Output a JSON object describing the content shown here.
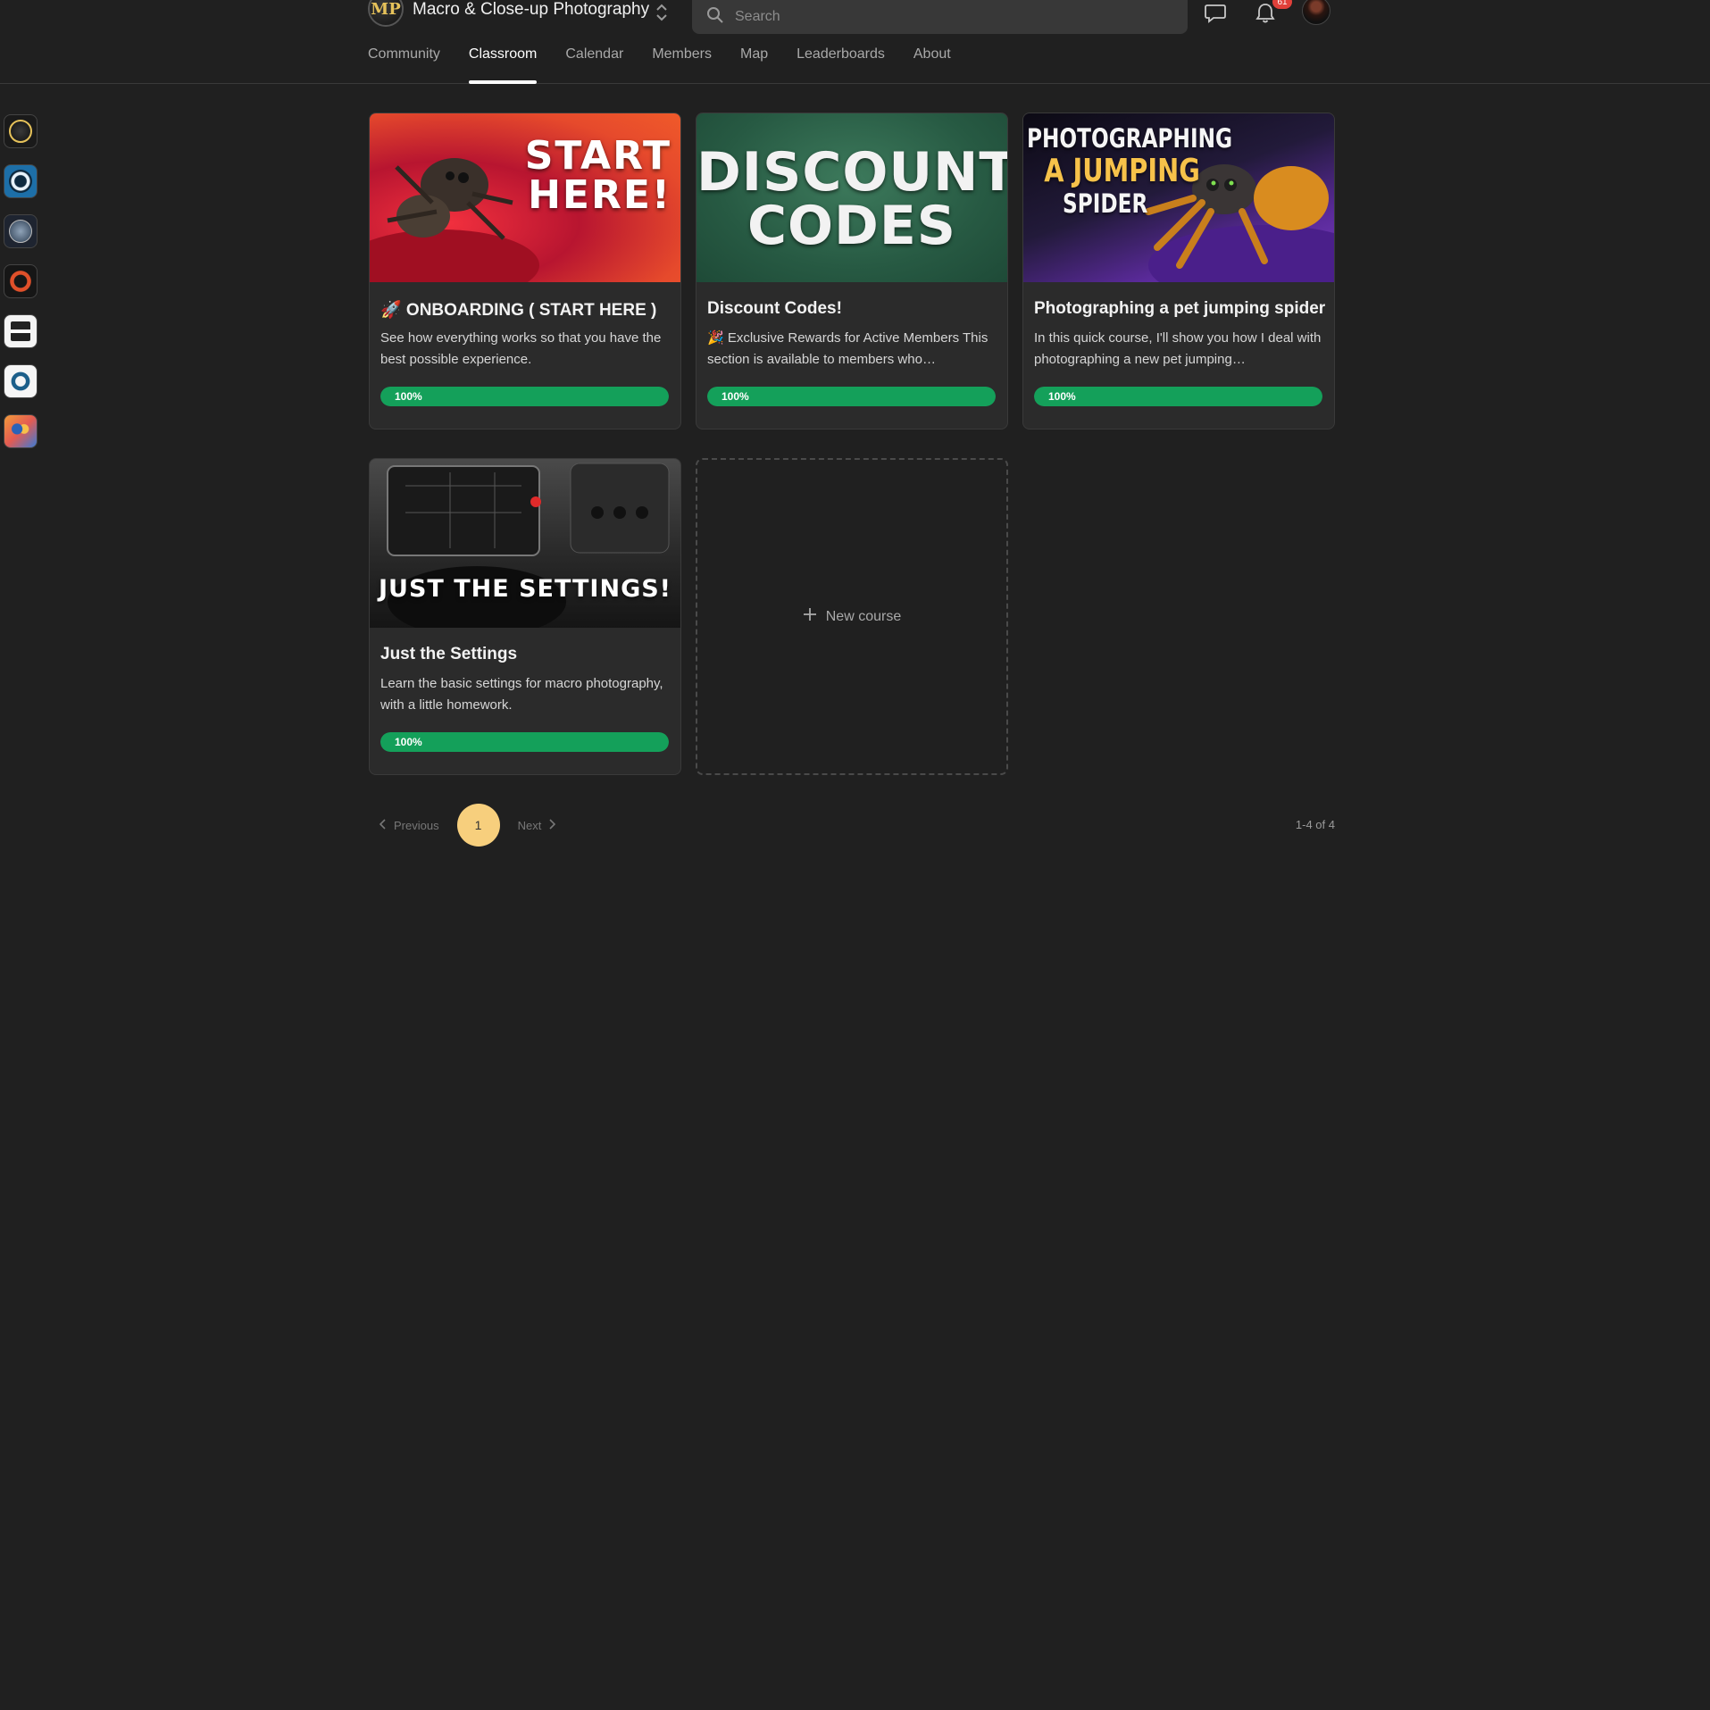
{
  "header": {
    "group_name": "Macro & Close-up Photography",
    "logo_text": "MP",
    "search_placeholder": "Search",
    "notification_count": "61"
  },
  "tabs": [
    {
      "label": "Community",
      "active": false
    },
    {
      "label": "Classroom",
      "active": true
    },
    {
      "label": "Calendar",
      "active": false
    },
    {
      "label": "Members",
      "active": false
    },
    {
      "label": "Map",
      "active": false
    },
    {
      "label": "Leaderboards",
      "active": false
    },
    {
      "label": "About",
      "active": false
    }
  ],
  "rail": {
    "icons": [
      "group-icon-macro-photography",
      "group-icon-camera-blue",
      "group-icon-globe",
      "group-icon-red-ring",
      "group-icon-bw-camera",
      "group-icon-blue-emblem",
      "group-icon-colorful-people"
    ]
  },
  "courses": [
    {
      "thumb_text": [
        "START",
        "HERE!"
      ],
      "title": "🚀 ONBOARDING ( START HERE )",
      "description": "See how everything works so that you have the best possible experience.",
      "progress_label": "100%",
      "progress": 100
    },
    {
      "thumb_text": [
        "DISCOUNT",
        "CODES"
      ],
      "title": "Discount Codes!",
      "description": "🎉 Exclusive Rewards for Active Members This section is available to members who…",
      "progress_label": "100%",
      "progress": 100
    },
    {
      "thumb_text": [
        "PHOTOGRAPHING",
        "A JUMPING",
        "SPIDER"
      ],
      "title": "Photographing a pet jumping spider",
      "description": "In this quick course, I'll show you how I deal with photographing a new pet jumping…",
      "progress_label": "100%",
      "progress": 100
    },
    {
      "thumb_text": [
        "JUST THE SETTINGS!"
      ],
      "title": "Just the Settings",
      "description": "Learn the basic settings for macro photography, with a little homework.",
      "progress_label": "100%",
      "progress": 100
    }
  ],
  "new_course_label": "New course",
  "pagination": {
    "previous": "Previous",
    "next": "Next",
    "current_page": "1",
    "count": "1-4 of 4"
  },
  "colors": {
    "background": "#202020",
    "card": "#2b2b2b",
    "progress": "#14a05a",
    "page_highlight": "#f7cf7d",
    "badge": "#e0403a"
  }
}
